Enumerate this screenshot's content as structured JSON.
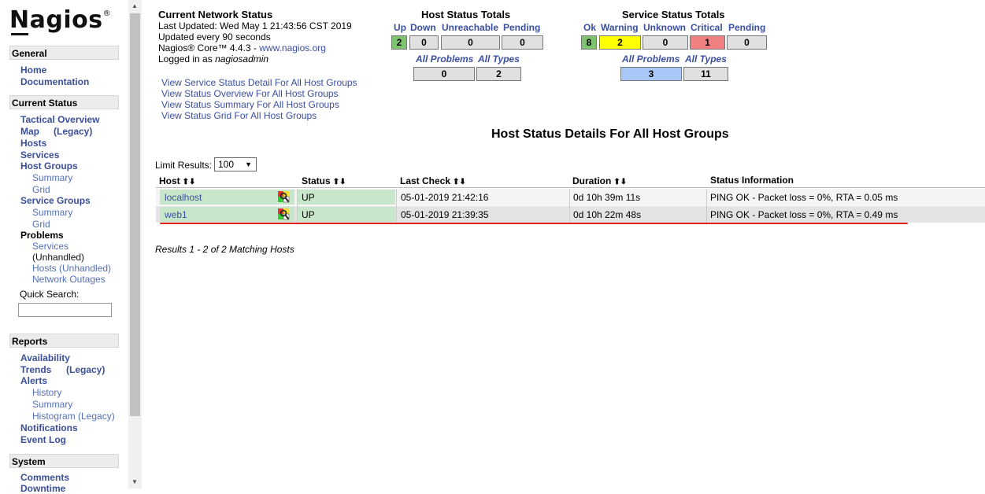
{
  "brand": {
    "name": "Nagios",
    "mark": "®"
  },
  "sidebar": {
    "general": {
      "title": "General",
      "items": [
        "Home",
        "Documentation"
      ]
    },
    "current_status": {
      "title": "Current Status",
      "tactical": "Tactical Overview",
      "map": "Map",
      "map_legacy": "(Legacy)",
      "hosts": "Hosts",
      "services": "Services",
      "host_groups": "Host Groups",
      "hg_summary": "Summary",
      "hg_grid": "Grid",
      "service_groups": "Service Groups",
      "sg_summary": "Summary",
      "sg_grid": "Grid",
      "problems": "Problems",
      "p_services": "Services",
      "p_unhandled": "(Unhandled)",
      "p_hosts": "Hosts",
      "p_hosts_unhandled": "(Unhandled)",
      "p_outages": "Network Outages",
      "quick_search": "Quick Search:"
    },
    "reports": {
      "title": "Reports",
      "availability": "Availability",
      "trends": "Trends",
      "trends_legacy": "(Legacy)",
      "alerts": "Alerts",
      "history": "History",
      "summary": "Summary",
      "histogram": "Histogram (Legacy)",
      "notifications": "Notifications",
      "event_log": "Event Log"
    },
    "system": {
      "title": "System",
      "comments": "Comments",
      "downtime": "Downtime"
    }
  },
  "status_info": {
    "title": "Current Network Status",
    "last_updated": "Last Updated: Wed May 1 21:43:56 CST 2019",
    "interval": "Updated every 90 seconds",
    "core_prefix": "Nagios® Core™ 4.4.3 - ",
    "core_link": "www.nagios.org",
    "logged_prefix": "Logged in as ",
    "logged_user": "nagiosadmin"
  },
  "view_links": [
    "View Service Status Detail For All Host Groups",
    "View Status Overview For All Host Groups",
    "View Status Summary For All Host Groups",
    "View Status Grid For All Host Groups"
  ],
  "host_totals": {
    "title": "Host Status Totals",
    "labels": {
      "up": "Up",
      "down": "Down",
      "unreachable": "Unreachable",
      "pending": "Pending"
    },
    "values": {
      "up": "2",
      "down": "0",
      "unreachable": "0",
      "pending": "0"
    },
    "all_problems_label": "All Problems",
    "all_types_label": "All Types",
    "all_problems": "0",
    "all_types": "2"
  },
  "service_totals": {
    "title": "Service Status Totals",
    "labels": {
      "ok": "Ok",
      "warning": "Warning",
      "unknown": "Unknown",
      "critical": "Critical",
      "pending": "Pending"
    },
    "values": {
      "ok": "8",
      "warning": "2",
      "unknown": "0",
      "critical": "1",
      "pending": "0"
    },
    "all_problems_label": "All Problems",
    "all_types_label": "All Types",
    "all_problems": "3",
    "all_types": "11"
  },
  "colors": {
    "ok": "#7ec46e",
    "warning": "#ffff00",
    "critical": "#f08080",
    "problems": "#a8c8f8",
    "up_row": "#c8e6c9"
  },
  "page_title": "Host Status Details For All Host Groups",
  "limit": {
    "label": "Limit Results:",
    "value": "100"
  },
  "table": {
    "headers": {
      "host": "Host",
      "status": "Status",
      "last_check": "Last Check",
      "duration": "Duration",
      "info": "Status Information"
    },
    "rows": [
      {
        "host": "localhost",
        "status": "UP",
        "last_check": "05-01-2019 21:42:16",
        "duration": "0d 10h 39m 11s",
        "info": "PING OK - Packet loss = 0%, RTA = 0.05 ms"
      },
      {
        "host": "web1",
        "status": "UP",
        "last_check": "05-01-2019 21:39:35",
        "duration": "0d 10h 22m 48s",
        "info": "PING OK - Packet loss = 0%, RTA = 0.49 ms"
      }
    ]
  },
  "results_text": "Results 1 - 2 of 2 Matching Hosts"
}
